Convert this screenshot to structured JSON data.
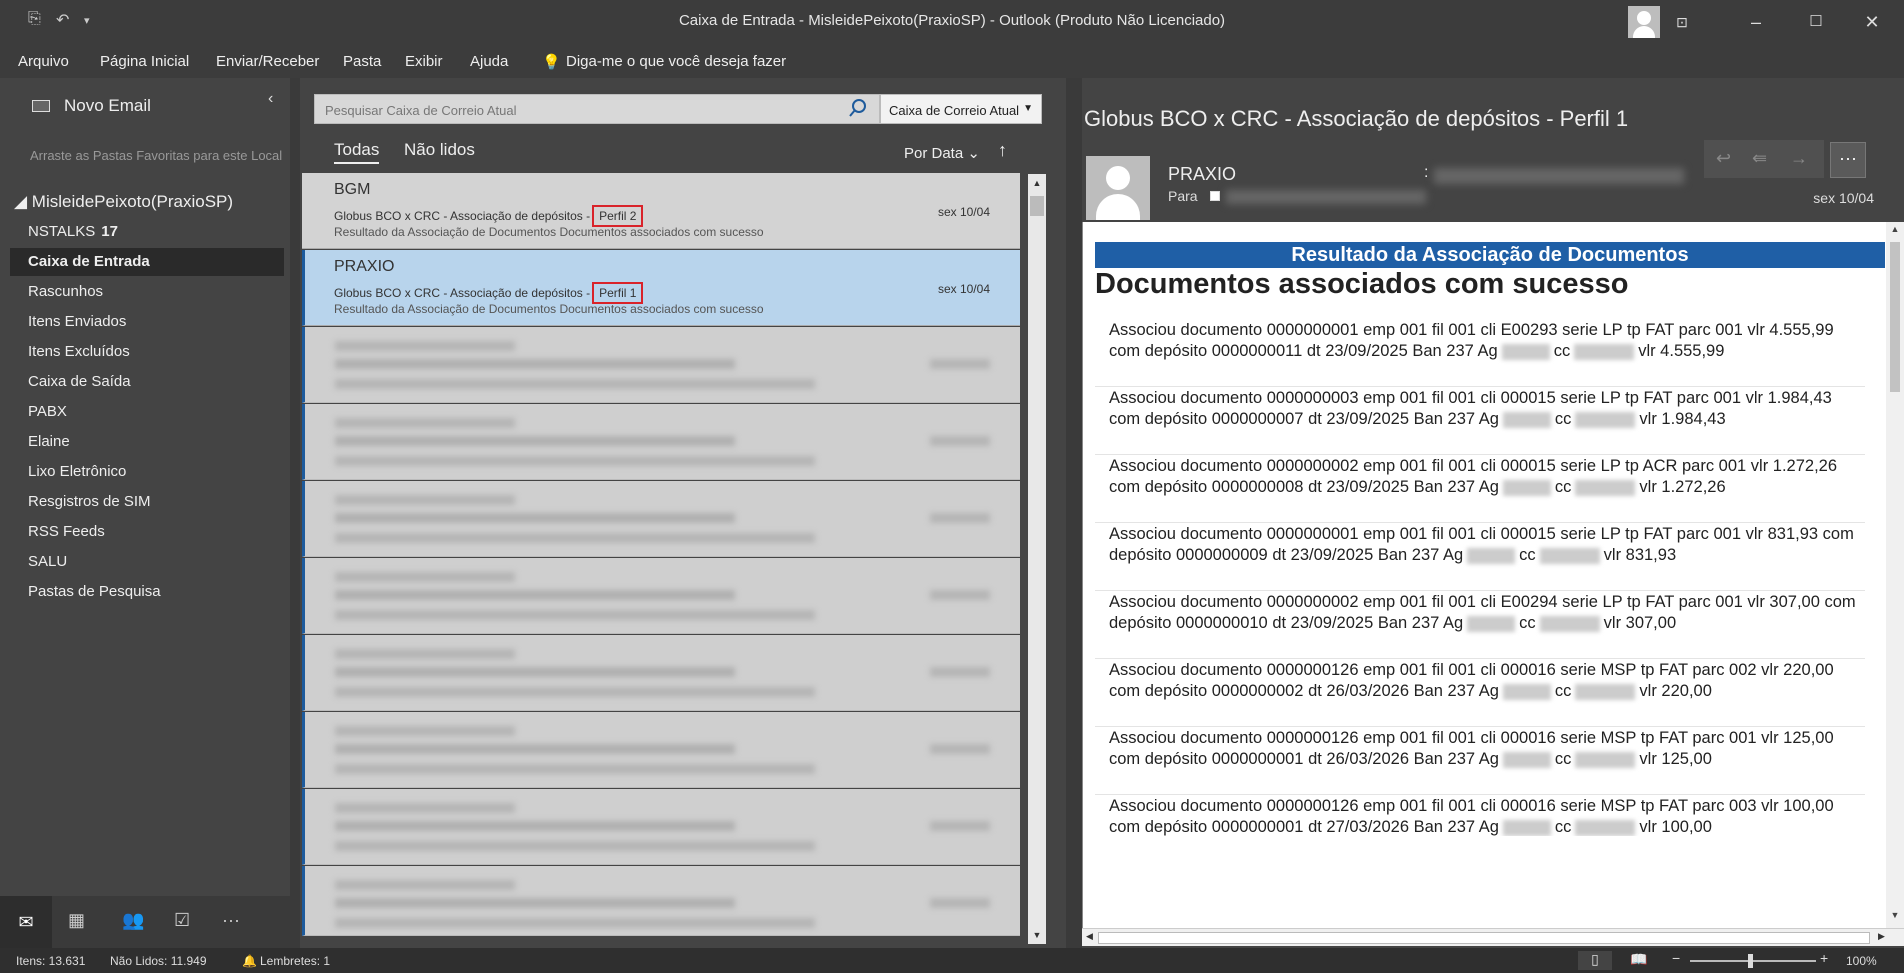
{
  "window": {
    "title": "Caixa de Entrada - MisleidePeixoto(PraxioSP)  -  Outlook (Produto Não Licenciado)"
  },
  "menu": [
    "Arquivo",
    "Página Inicial",
    "Enviar/Receber",
    "Pasta",
    "Exibir",
    "Ajuda"
  ],
  "tell_me": "Diga-me o que você deseja fazer",
  "nav": {
    "new_mail": "Novo Email",
    "favorites_hint": "Arraste as Pastas Favoritas para este Local",
    "account": "MisleidePeixoto(PraxioSP)",
    "folders": [
      {
        "label": "NSTALKS",
        "count": "17"
      },
      {
        "label": "Caixa de Entrada",
        "count": ""
      },
      {
        "label": "Rascunhos",
        "count": ""
      },
      {
        "label": "Itens Enviados",
        "count": ""
      },
      {
        "label": "Itens Excluídos",
        "count": ""
      },
      {
        "label": "Caixa de Saída",
        "count": ""
      },
      {
        "label": "PABX",
        "count": ""
      },
      {
        "label": "Elaine",
        "count": ""
      },
      {
        "label": "Lixo Eletrônico",
        "count": ""
      },
      {
        "label": "Resgistros de SIM",
        "count": ""
      },
      {
        "label": "RSS Feeds",
        "count": ""
      },
      {
        "label": "SALU",
        "count": ""
      },
      {
        "label": "Pastas de Pesquisa",
        "count": ""
      }
    ],
    "selected_folder": "Caixa de Entrada"
  },
  "list": {
    "search_placeholder": "Pesquisar Caixa de Correio Atual",
    "scope": "Caixa de Correio Atual",
    "tabs": [
      "Todas",
      "Não lidos"
    ],
    "sort": "Por Data",
    "messages": [
      {
        "from": "BGM",
        "subject": "Globus BCO x CRC - Associação de depósitos -",
        "tag": "Perfil 2",
        "preview": "Resultado da Associação de Documentos  Documentos associados com sucesso",
        "date": "sex 10/04"
      },
      {
        "from": "PRAXIO",
        "subject": "Globus BCO x CRC - Associação de depósitos -",
        "tag": "Perfil 1",
        "preview": "Resultado da Associação de Documentos  Documentos associados com sucesso",
        "date": "sex 10/04"
      }
    ]
  },
  "reader": {
    "title": "Globus BCO x CRC - Associação de depósitos - Perfil 1",
    "sender": "PRAXIO",
    "colon": ":",
    "to_label": "Para",
    "date": "sex 10/04",
    "more": "···",
    "banner": "Resultado da Associação de Documentos",
    "heading": "Documentos associados com sucesso",
    "entries": [
      {
        "l1": "Associou documento 0000000001 emp 001 fil 001 cli E00293 serie LP tp FAT parc 001 vlr 4.555,99",
        "l2a": "com depósito 0000000011 dt 23/09/2025 Ban 237 Ag",
        "l2b": "cc",
        "l2c": "vlr 4.555,99"
      },
      {
        "l1": "Associou documento 0000000003 emp 001 fil 001 cli 000015 serie LP tp FAT parc 001 vlr 1.984,43",
        "l2a": "com depósito 0000000007 dt 23/09/2025 Ban 237 Ag",
        "l2b": "cc",
        "l2c": "vlr 1.984,43"
      },
      {
        "l1": "Associou documento 0000000002 emp 001 fil 001 cli 000015 serie LP tp ACR parc 001 vlr 1.272,26",
        "l2a": "com depósito 0000000008 dt 23/09/2025 Ban 237 Ag",
        "l2b": "cc",
        "l2c": "vlr 1.272,26"
      },
      {
        "l1": "Associou documento 0000000001 emp 001 fil 001 cli 000015 serie LP tp FAT parc 001 vlr 831,93 com",
        "l2a": "depósito 0000000009 dt 23/09/2025 Ban 237 Ag",
        "l2b": "cc",
        "l2c": "vlr 831,93"
      },
      {
        "l1": "Associou documento 0000000002 emp 001 fil 001 cli E00294 serie LP tp FAT parc 001 vlr 307,00 com",
        "l2a": "depósito 0000000010 dt 23/09/2025 Ban 237 Ag",
        "l2b": "cc",
        "l2c": "vlr 307,00"
      },
      {
        "l1": "Associou documento 0000000126 emp 001 fil 001 cli 000016 serie MSP tp FAT parc 002 vlr 220,00",
        "l2a": "com depósito 0000000002 dt 26/03/2026 Ban 237 Ag",
        "l2b": "cc",
        "l2c": "vlr 220,00"
      },
      {
        "l1": "Associou documento 0000000126 emp 001 fil 001 cli 000016 serie MSP tp FAT parc 001 vlr 125,00",
        "l2a": "com depósito 0000000001 dt 26/03/2026 Ban 237 Ag",
        "l2b": "cc",
        "l2c": "vlr 125,00"
      },
      {
        "l1": "Associou documento 0000000126 emp 001 fil 001 cli 000016 serie MSP tp FAT parc 003 vlr 100,00",
        "l2a": "com depósito 0000000001 dt 27/03/2026 Ban 237 Ag",
        "l2b": "cc",
        "l2c": "vlr 100,00"
      }
    ]
  },
  "status": {
    "items": "Itens: 13.631",
    "unread": "Não Lidos: 11.949",
    "reminders": "Lembretes: 1",
    "zoom": "100%"
  }
}
